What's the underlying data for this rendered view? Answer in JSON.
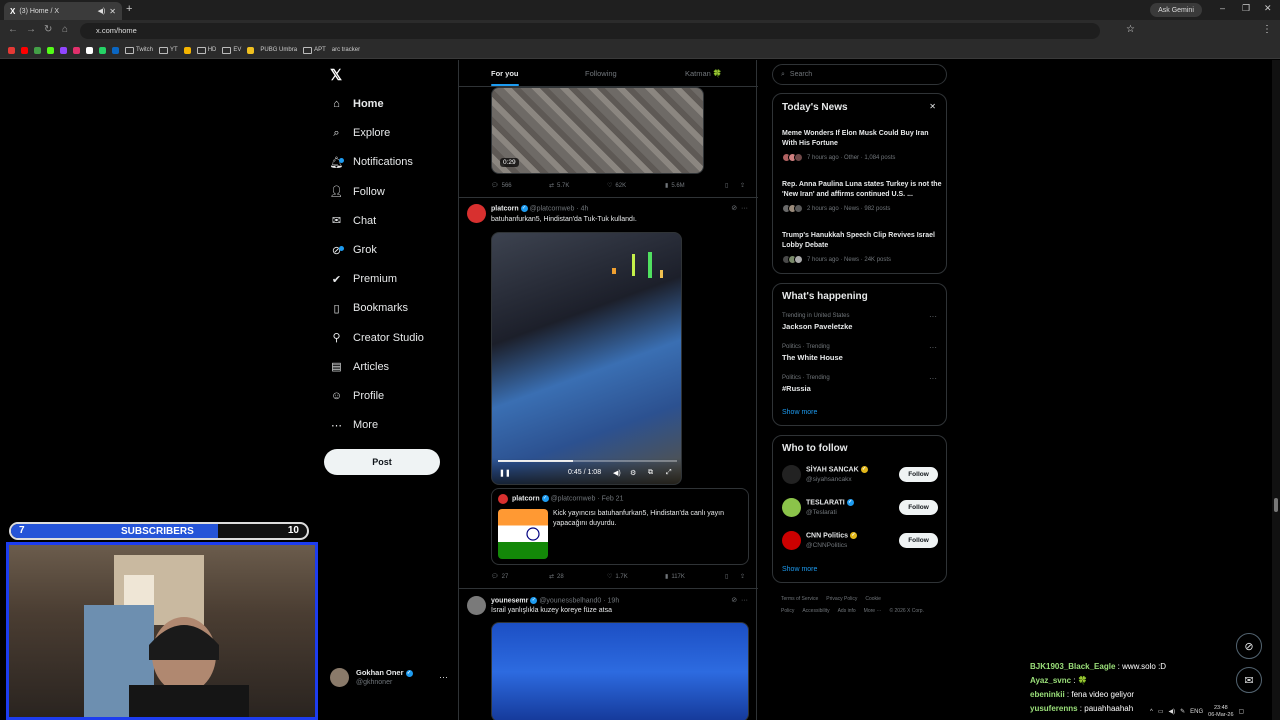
{
  "browser": {
    "tab_title": "(3) Home / X",
    "new_tab": "+",
    "gemini_label": "Ask Gemini",
    "url": "x.com/home",
    "bookmarks": [
      "Twitch",
      "YT",
      "HD",
      "EV",
      "PUBG Umbra",
      "APT",
      "arc tracker"
    ]
  },
  "nav": {
    "logo": "𝕏",
    "items": [
      {
        "label": "Home",
        "icon": "home-icon"
      },
      {
        "label": "Explore",
        "icon": "search-icon"
      },
      {
        "label": "Notifications",
        "icon": "bell-icon"
      },
      {
        "label": "Follow",
        "icon": "follow-icon"
      },
      {
        "label": "Chat",
        "icon": "mail-icon"
      },
      {
        "label": "Grok",
        "icon": "grok-icon"
      },
      {
        "label": "Premium",
        "icon": "premium-icon"
      },
      {
        "label": "Bookmarks",
        "icon": "bookmark-icon"
      },
      {
        "label": "Creator Studio",
        "icon": "creator-icon"
      },
      {
        "label": "Articles",
        "icon": "article-icon"
      },
      {
        "label": "Profile",
        "icon": "profile-icon"
      },
      {
        "label": "More",
        "icon": "more-icon"
      }
    ],
    "post_label": "Post",
    "account": {
      "name": "Gokhan Oner",
      "handle": "@gkhnoner"
    }
  },
  "feed": {
    "tabs": [
      "For you",
      "Following",
      "Katman 🍀"
    ],
    "tweet1": {
      "duration": "0:29",
      "replies": "566",
      "reposts": "5.7K",
      "likes": "62K",
      "views": "5.6M"
    },
    "tweet2": {
      "name": "platcorn",
      "handle": "@platcornweb",
      "time": "· 4h",
      "text": "batuhanfurkan5, Hindistan'da Tuk-Tuk kullandı.",
      "video_time": "0:45 / 1:08",
      "quote": {
        "name": "platcorn",
        "handle": "@platcornweb",
        "time": "· Feb 21",
        "text": "Kick yayıncısı batuhanfurkan5, Hindistan'da canlı yayın yapacağını duyurdu."
      },
      "replies": "27",
      "reposts": "28",
      "likes": "1.7K",
      "views": "117K"
    },
    "tweet3": {
      "name": "younesemr",
      "handle": "@younessbelhand0",
      "time": "· 19h",
      "text": "İsrail yanlışlıkla kuzey koreye füze atsa"
    }
  },
  "sidebar": {
    "search_placeholder": "Search",
    "news_title": "Today's News",
    "news": [
      {
        "title": "Meme Wonders If Elon Musk Could Buy Iran With His Fortune",
        "meta": "7 hours ago · Other · 1,084 posts"
      },
      {
        "title": "Rep. Anna Paulina Luna states Turkey is not the 'New Iran' and affirms continued U.S. ...",
        "meta": "2 hours ago · News · 982 posts"
      },
      {
        "title": "Trump's Hanukkah Speech Clip Revives Israel Lobby Debate",
        "meta": "7 hours ago · News · 24K posts"
      }
    ],
    "happening_title": "What's happening",
    "trends": [
      {
        "category": "Trending in United States",
        "name": "Jackson Paveletzke"
      },
      {
        "category": "Politics · Trending",
        "name": "The White House"
      },
      {
        "category": "Politics · Trending",
        "name": "#Russia"
      }
    ],
    "show_more": "Show more",
    "wtf_title": "Who to follow",
    "who_to_follow": [
      {
        "name": "SİYAH SANCAK",
        "handle": "@siyahsancakx",
        "color": "#222222"
      },
      {
        "name": "TESLARATI",
        "handle": "@Teslarati",
        "color": "#8bc34a"
      },
      {
        "name": "CNN Politics",
        "handle": "@CNNPolitics",
        "color": "#cc0000"
      }
    ],
    "follow_label": "Follow",
    "footer": [
      "Terms of Service",
      "Privacy Policy",
      "Cookie Policy",
      "Accessibility",
      "Ads info",
      "More ···",
      "© 2026 X Corp."
    ]
  },
  "overlay": {
    "sub_left": "7",
    "sub_label": "SUBSCRIBERS",
    "sub_right": "10",
    "sub_progress": 0.7,
    "chat": [
      {
        "user": "BJK1903_Black_Eagle",
        "msg": "www.solo :D"
      },
      {
        "user": "Ayaz_svnc",
        "msg": "🍀"
      },
      {
        "user": "ebeninkii",
        "msg": "fena video geliyor"
      },
      {
        "user": "yusuferenns",
        "msg": "pauahhaahah"
      }
    ]
  },
  "taskbar": {
    "lang": "ENG",
    "time": "23:48",
    "date": "06-Mar-26"
  },
  "colors": {
    "accent": "#1d9bf0",
    "bg": "#000000",
    "border": "#2f3336"
  }
}
